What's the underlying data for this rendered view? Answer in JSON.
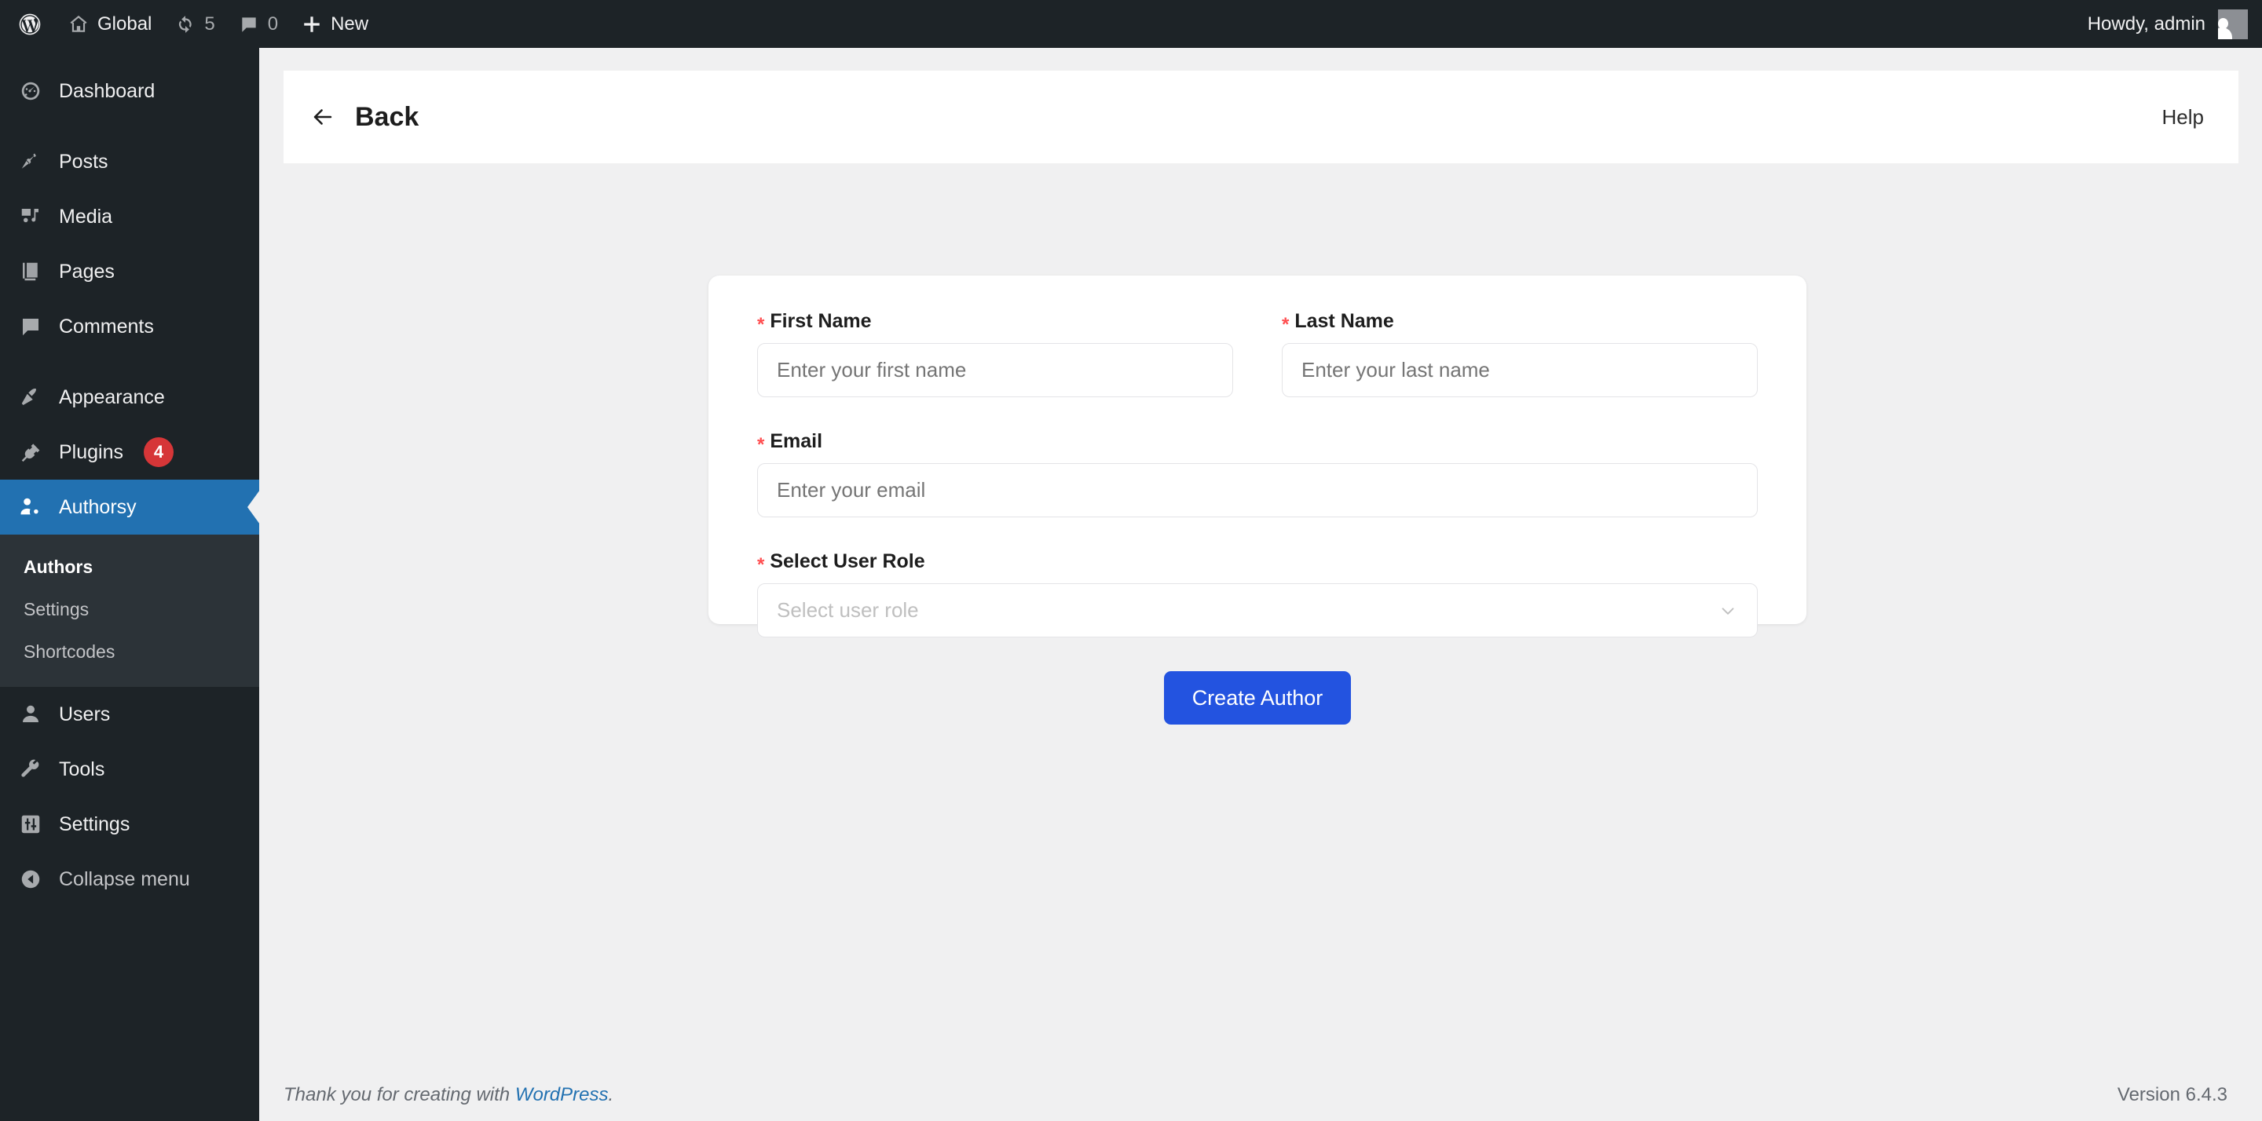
{
  "adminbar": {
    "wp_logo_label": "",
    "site_name": "Global",
    "updates_count": "5",
    "comments_count": "0",
    "new_label": "New",
    "howdy": "Howdy, admin"
  },
  "sidebar": {
    "items": [
      {
        "label": "Dashboard",
        "icon": "dashboard-icon"
      },
      {
        "label": "Posts",
        "icon": "pin-icon"
      },
      {
        "label": "Media",
        "icon": "media-icon"
      },
      {
        "label": "Pages",
        "icon": "pages-icon"
      },
      {
        "label": "Comments",
        "icon": "comment-icon"
      },
      {
        "label": "Appearance",
        "icon": "paintbrush-icon"
      },
      {
        "label": "Plugins",
        "icon": "plug-icon",
        "badge": "4"
      },
      {
        "label": "Authorsy",
        "icon": "user-gear-icon",
        "current": true
      },
      {
        "label": "Users",
        "icon": "user-icon"
      },
      {
        "label": "Tools",
        "icon": "wrench-icon"
      },
      {
        "label": "Settings",
        "icon": "sliders-icon"
      },
      {
        "label": "Collapse menu",
        "icon": "collapse-icon"
      }
    ],
    "submenu": [
      {
        "label": "Authors",
        "current": true
      },
      {
        "label": "Settings",
        "current": false
      },
      {
        "label": "Shortcodes",
        "current": false
      }
    ]
  },
  "header": {
    "back_label": "Back",
    "help_label": "Help"
  },
  "form": {
    "first_name": {
      "label": "First Name",
      "required_mark": "*",
      "placeholder": "Enter your first name",
      "value": ""
    },
    "last_name": {
      "label": "Last Name",
      "required_mark": "*",
      "placeholder": "Enter your last name",
      "value": ""
    },
    "email": {
      "label": "Email",
      "required_mark": "*",
      "placeholder": "Enter your email",
      "value": ""
    },
    "user_role": {
      "label": "Select User Role",
      "required_mark": "*",
      "placeholder": "Select user role",
      "value": ""
    },
    "submit_label": "Create Author"
  },
  "footer": {
    "thanks_text": "Thank you for creating with ",
    "wordpress_link": "WordPress",
    "period": ".",
    "version": "Version 6.4.3"
  },
  "colors": {
    "accent_blue": "#2271b1",
    "button_blue": "#2353e0",
    "required_red": "#ff4d4f",
    "badge_red": "#d63638",
    "sidebar_bg": "#1d2327",
    "submenu_bg": "#2c3338"
  }
}
